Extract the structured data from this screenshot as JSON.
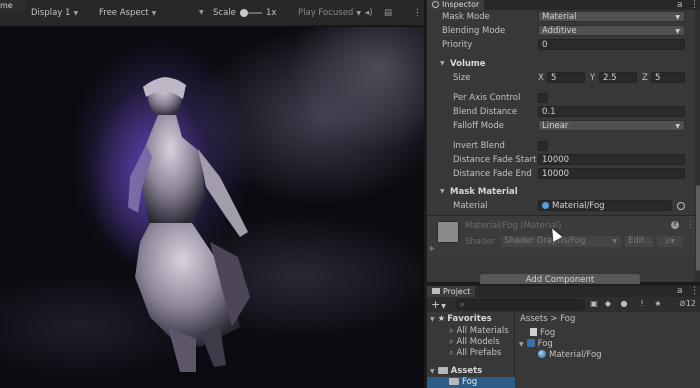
{
  "game_view": {
    "tab_title": "me",
    "display": "Display 1",
    "aspect": "Free Aspect",
    "scale_label": "Scale",
    "scale_value": "1x",
    "play_mode": "Play Focused"
  },
  "inspector": {
    "title": "Inspector",
    "rows": {
      "mask_mode_label": "Mask Mode",
      "mask_mode_value": "Material",
      "blending_mode_label": "Blending Mode",
      "blending_mode_value": "Additive",
      "priority_label": "Priority",
      "priority_value": "0",
      "volume_section": "Volume",
      "size_label": "Size",
      "size_x_axis": "X",
      "size_x": "5",
      "size_y_axis": "Y",
      "size_y": "2.5",
      "size_z_axis": "Z",
      "size_z": "5",
      "per_axis_control_label": "Per Axis Control",
      "blend_distance_label": "Blend Distance",
      "blend_distance_value": "0.1",
      "falloff_mode_label": "Falloff Mode",
      "falloff_mode_value": "Linear",
      "invert_blend_label": "Invert Blend",
      "distance_fade_start_label": "Distance Fade Start",
      "distance_fade_start_value": "10000",
      "distance_fade_end_label": "Distance Fade End",
      "distance_fade_end_value": "10000",
      "mask_material_section": "Mask Material",
      "material_label": "Material",
      "material_value": "Material/Fog"
    },
    "material_block": {
      "name": "Material/Fog (Material)",
      "shader_label": "Shader",
      "shader_value": "Shader Graphs/Fog",
      "edit_label": "Edit..."
    },
    "add_component_label": "Add Component"
  },
  "project": {
    "title": "Project",
    "hidden_count": "12",
    "favorites": {
      "label": "Favorites",
      "items": [
        "All Materials",
        "All Models",
        "All Prefabs"
      ]
    },
    "assets": {
      "label": "Assets",
      "selected_folder": "Fog"
    },
    "breadcrumb": "Assets > Fog",
    "files": [
      {
        "name": "Fog",
        "icon": "shader-file-icon"
      },
      {
        "name": "Fog",
        "icon": "prefab-icon"
      },
      {
        "name": "Material/Fog",
        "icon": "material-icon"
      }
    ]
  },
  "colors": {
    "panel_bg": "#383838",
    "header_bg": "#282828",
    "selection": "#2c5d87",
    "fog_tint": "#6e50c8"
  }
}
